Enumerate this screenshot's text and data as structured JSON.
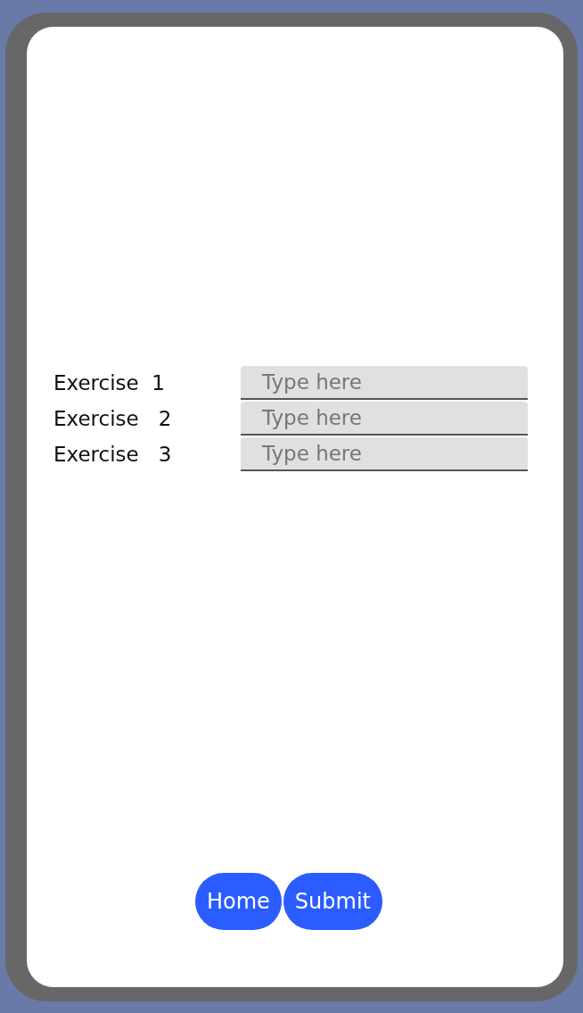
{
  "exercises": [
    {
      "label": "Exercise  1",
      "placeholder": "Type here"
    },
    {
      "label": "Exercise   2",
      "placeholder": "Type here"
    },
    {
      "label": "Exercise   3",
      "placeholder": "Type here"
    }
  ],
  "buttons": [
    "Home",
    "Submit"
  ]
}
